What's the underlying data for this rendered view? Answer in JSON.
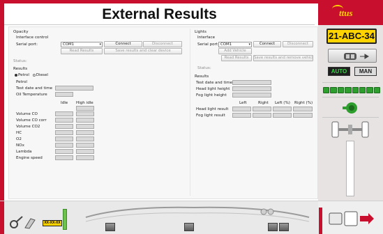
{
  "window": {
    "title": "External Results"
  },
  "opacity": {
    "section_title": "Opacity",
    "interface_control": "Interface control",
    "serial_port_label": "Serial port:",
    "serial_port_value": "COM1",
    "connect": "Connect",
    "disconnect": "Disconnect",
    "read_results": "Read Results",
    "save_clear": "Save results and clear device",
    "status": "Status:",
    "results": "Results",
    "fuel_petrol": "Petrol",
    "fuel_diesel": "Diesel",
    "petrol_heading": "Petrol",
    "test_date_time": "Test date and time",
    "oil_temperature": "Oil Temperature",
    "col_idle": "Idle",
    "col_high_idle": "High idle",
    "rows": [
      "Volume CO",
      "Volume CO corr",
      "Volume CO2",
      "HC",
      "O2",
      "NOx",
      "Lambda",
      "Engine speed"
    ]
  },
  "lights": {
    "section_title": "Lights",
    "interface": "Interface",
    "serial_port_label": "Serial port:",
    "serial_port_value": "COM1",
    "connect": "Connect",
    "disconnect": "Disconnect",
    "add_vehicle": "Add Vehicle",
    "read_results": "Read Results",
    "save_remove": "Save results and remove vehicle",
    "status": "Status:",
    "results": "Results",
    "test_date_time": "Test date and time",
    "head_light_height": "Head light height",
    "fog_light_height": "Fog light height",
    "col_left": "Left",
    "col_right": "Right",
    "col_left_pct": "Left (%)",
    "col_right_pct": "Right (%)",
    "head_light_result": "Head light result",
    "fog_light_result": "Fog light result"
  },
  "sidebar": {
    "logo": "ttus",
    "plate": "21-ABC-34",
    "auto": "AUTO",
    "man": "MAN",
    "led_count": 8,
    "colors": {
      "accent": "#c8102e",
      "plate": "#ffd400",
      "led": "#2e9e2e"
    }
  },
  "bottom": {
    "mini_plate": "XX-XX-XX"
  }
}
